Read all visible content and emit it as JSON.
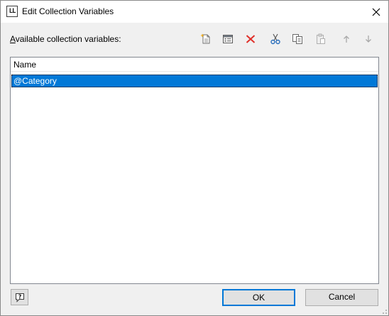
{
  "window": {
    "title": "Edit Collection Variables",
    "app_icon_text": "LL"
  },
  "vars_label": {
    "accel": "A",
    "rest": "vailable collection variables:"
  },
  "toolbar": {
    "icons": [
      "new-document-icon",
      "properties-icon",
      "delete-icon",
      "cut-icon",
      "copy-icon",
      "paste-icon",
      "move-up-icon",
      "move-down-icon"
    ],
    "colors": {
      "delete": "#e0302a",
      "cut": "#2a6fbd",
      "disabled": "#a8a8a8"
    }
  },
  "list": {
    "column_header": "Name",
    "items": [
      {
        "label": "@Category",
        "selected": true
      }
    ],
    "selection_color": "#0078d7"
  },
  "buttons": {
    "ok": "OK",
    "cancel": "Cancel"
  }
}
